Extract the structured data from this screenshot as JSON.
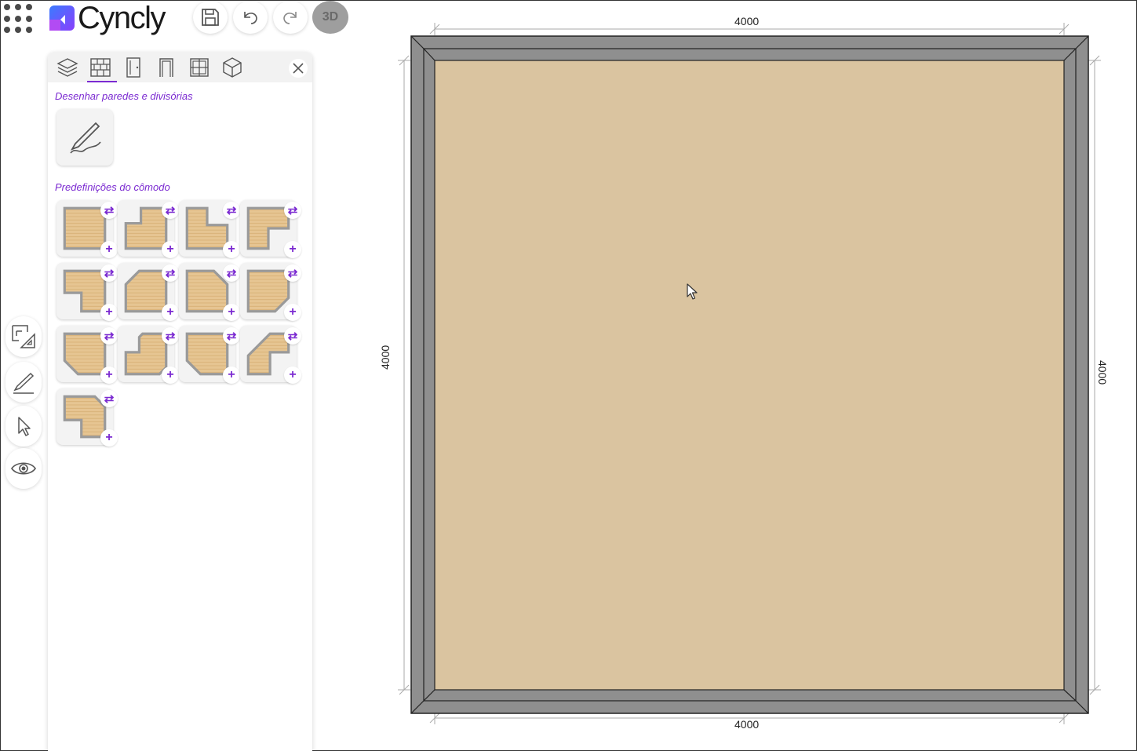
{
  "app": {
    "brand": "Cyncly",
    "mode_button": "3D"
  },
  "colors": {
    "accent": "#7b2ad1",
    "floor": "#dac4a0",
    "wall": "#8f8f8f",
    "wood": "#e6c592"
  },
  "toolbar": {
    "icons": [
      "apps-grid-icon",
      "save-icon",
      "undo-icon",
      "redo-icon"
    ]
  },
  "side_tools": [
    "floorplan-measure-icon",
    "pencil-icon",
    "cursor-icon",
    "eye-icon"
  ],
  "panel": {
    "tabs": [
      "layers-icon",
      "wall-icon",
      "door-icon",
      "opening-icon",
      "window-icon",
      "cube-icon"
    ],
    "active_tab": 1,
    "draw_section_title": "Desenhar paredes e divisórias",
    "presets_section_title": "Predefinições do cômodo",
    "preset_swap_symbol": "⇄",
    "preset_add_symbol": "+",
    "presets": [
      "rectangle",
      "notch-top-left",
      "notch-top-left-small",
      "notch-bottom-right",
      "notch-bottom-left",
      "chamfer-top-left",
      "chamfer-top-right",
      "chamfer-bottom-right",
      "chamfer-bottom-left",
      "step-top-right",
      "chamfer-two-left",
      "step-right-chamfer",
      "l-shape"
    ]
  },
  "canvas": {
    "dims": {
      "top": "4000",
      "bottom": "4000",
      "left": "4000",
      "right": "4000"
    }
  }
}
